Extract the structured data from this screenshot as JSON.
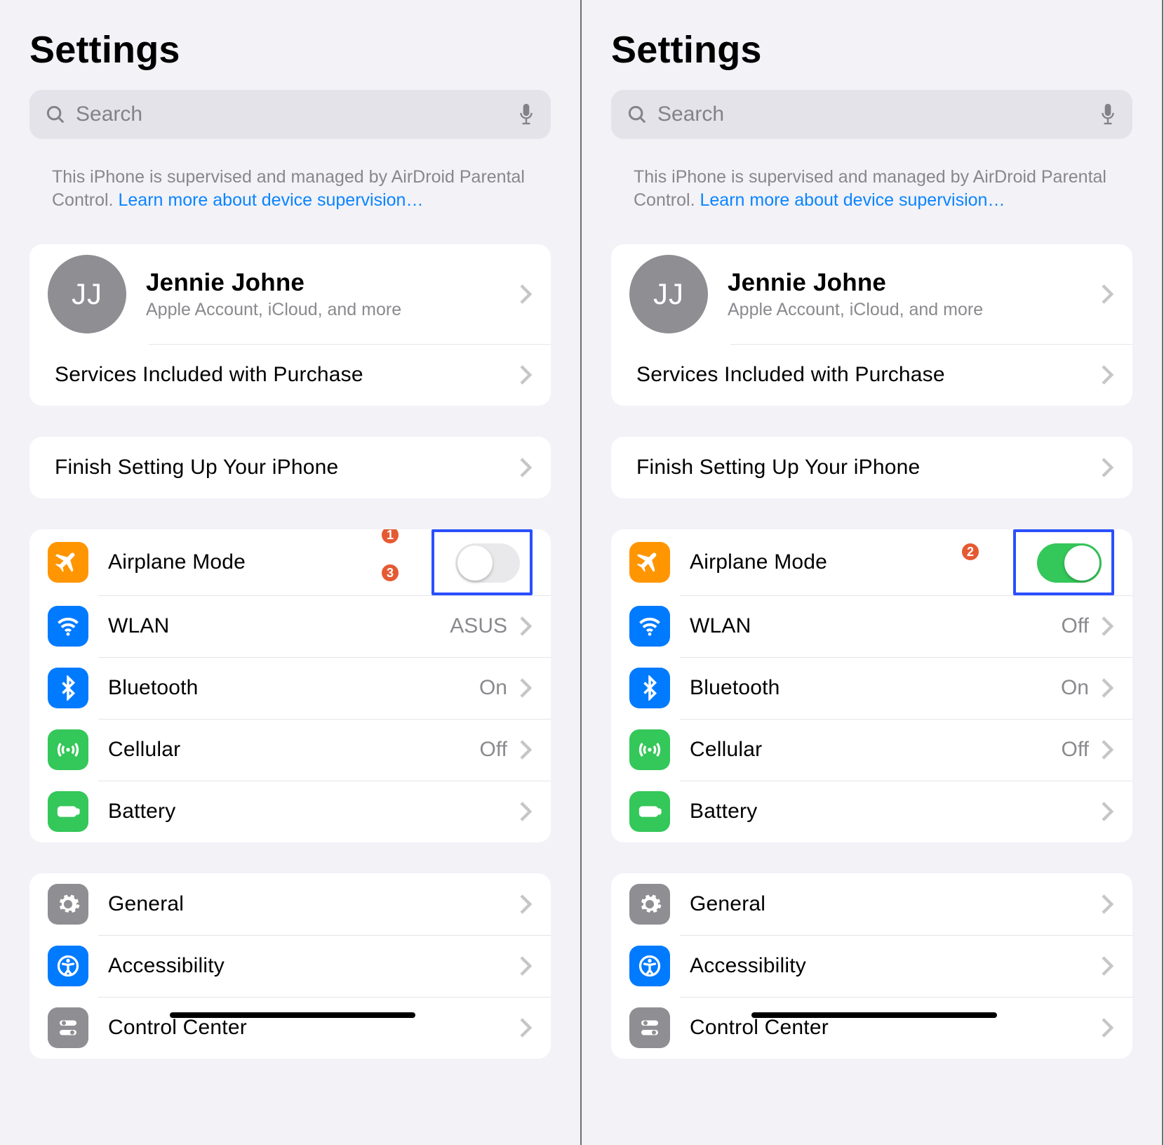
{
  "panels": [
    {
      "title": "Settings",
      "search_placeholder": "Search",
      "supervision_text": "This iPhone is supervised and managed by AirDroid Parental Control. ",
      "supervision_link": "Learn more about device supervision…",
      "profile": {
        "initials": "JJ",
        "name": "Jennie Johne",
        "subtitle": "Apple Account, iCloud, and more"
      },
      "services_label": "Services Included with Purchase",
      "finish_label": "Finish Setting Up Your iPhone",
      "airplane": {
        "label": "Airplane Mode",
        "on": false
      },
      "wlan": {
        "label": "WLAN",
        "value": "ASUS"
      },
      "bluetooth": {
        "label": "Bluetooth",
        "value": "On"
      },
      "cellular": {
        "label": "Cellular",
        "value": "Off"
      },
      "battery": {
        "label": "Battery"
      },
      "general": {
        "label": "General"
      },
      "accessibility": {
        "label": "Accessibility"
      },
      "control_center": {
        "label": "Control Center"
      },
      "annotations": {
        "badge_top": "1",
        "badge_bottom": "3"
      }
    },
    {
      "title": "Settings",
      "search_placeholder": "Search",
      "supervision_text": "This iPhone is supervised and managed by AirDroid Parental Control. ",
      "supervision_link": "Learn more about device supervision…",
      "profile": {
        "initials": "JJ",
        "name": "Jennie Johne",
        "subtitle": "Apple Account, iCloud, and more"
      },
      "services_label": "Services Included with Purchase",
      "finish_label": "Finish Setting Up Your iPhone",
      "airplane": {
        "label": "Airplane Mode",
        "on": true
      },
      "wlan": {
        "label": "WLAN",
        "value": "Off"
      },
      "bluetooth": {
        "label": "Bluetooth",
        "value": "On"
      },
      "cellular": {
        "label": "Cellular",
        "value": "Off"
      },
      "battery": {
        "label": "Battery"
      },
      "general": {
        "label": "General"
      },
      "accessibility": {
        "label": "Accessibility"
      },
      "control_center": {
        "label": "Control Center"
      },
      "annotations": {
        "badge": "2"
      }
    }
  ]
}
